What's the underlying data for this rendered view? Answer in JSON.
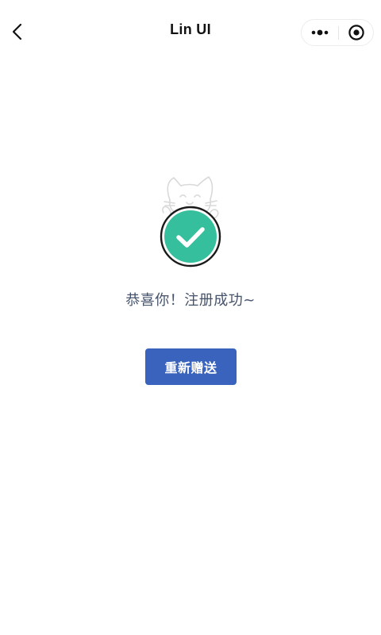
{
  "navbar": {
    "title": "Lin UI"
  },
  "status": {
    "message": "恭喜你！注册成功~",
    "icon": "success-check-icon",
    "mascot": "cat-mascot-icon",
    "accent_color": "#35bf9c"
  },
  "actions": {
    "resend_label": "重新赠送",
    "button_color": "#3963bc"
  }
}
